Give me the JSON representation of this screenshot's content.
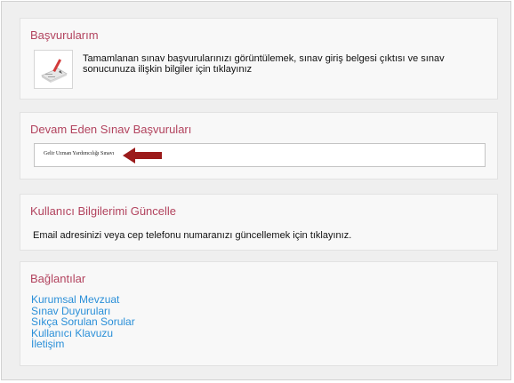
{
  "basvurularim": {
    "title": "Başvurularım",
    "thumbnail_icon": "document-pencil-icon",
    "description": "Tamamlanan sınav başvurularınızı görüntülemek, sınav giriş belgesi çıktısı ve sınav sonucunuza ilişkin bilgiler için tıklayınız"
  },
  "devam_eden": {
    "title": "Devam Eden Sınav Başvuruları",
    "application_link": "Gelir Uzman Yardımcılığı Sınavı",
    "arrow_icon": "red-arrow-left-icon",
    "arrow_color": "#9b1b1b"
  },
  "kullanici": {
    "title": "Kullanıcı Bilgilerimi Güncelle",
    "description": "Email adresinizi veya cep telefonu numaranızı güncellemek için tıklayınız."
  },
  "baglantilar": {
    "title": "Bağlantılar",
    "links": [
      {
        "label": "Kurumsal Mevzuat"
      },
      {
        "label": "Sınav Duyuruları"
      },
      {
        "label": "Sıkça Sorulan Sorular"
      },
      {
        "label": "Kullanıcı Klavuzu"
      },
      {
        "label": "İletişim"
      }
    ]
  },
  "colors": {
    "title_accent": "#b2435e",
    "link": "#2a8fd8",
    "panel_bg": "#f8f8f8",
    "page_bg": "#efefef"
  }
}
